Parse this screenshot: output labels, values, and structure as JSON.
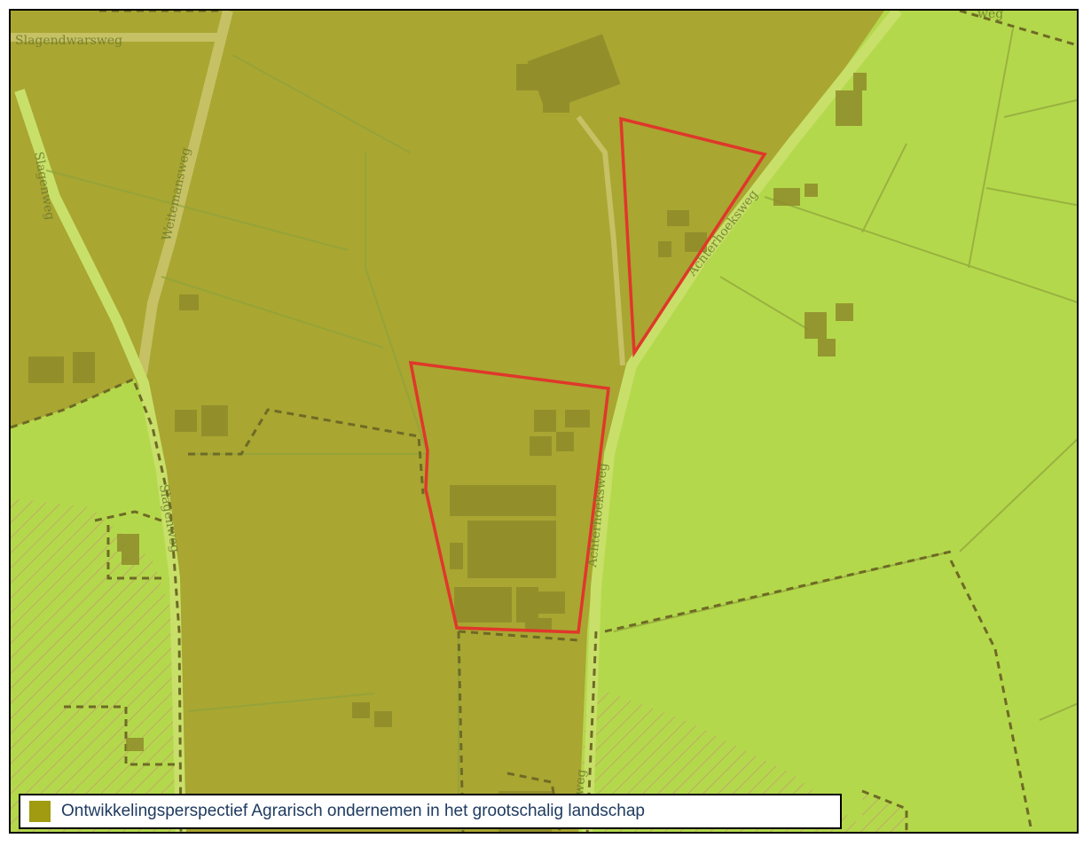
{
  "map": {
    "street_labels": {
      "slagendwarsweg": "Slagendwarsweg",
      "weitemansweg": "Weitemansweg",
      "slagenweg_top": "Slagenweg",
      "slagenweg_bottom": "Slagenweg",
      "achterhoeksweg_top": "Achterhoeksweg",
      "achterhoeksweg_bottom": "Achterhoeksweg",
      "partial_weg_bottom": "weg",
      "partial_weg_top": "weg"
    },
    "colors": {
      "agrarisch_zone": "#a9a632",
      "other_zone": "#b4d84c",
      "plot_outline": "#e0372b",
      "buildings": "#8f8c2a",
      "roads": "#c6c164",
      "dashed_boundary": "#6e6a25",
      "hatch": "#c98b7a"
    }
  },
  "legend": {
    "swatch_color": "#a09b10",
    "label": "Ontwikkelingsperspectief Agrarisch ondernemen in het grootschalig landschap"
  }
}
